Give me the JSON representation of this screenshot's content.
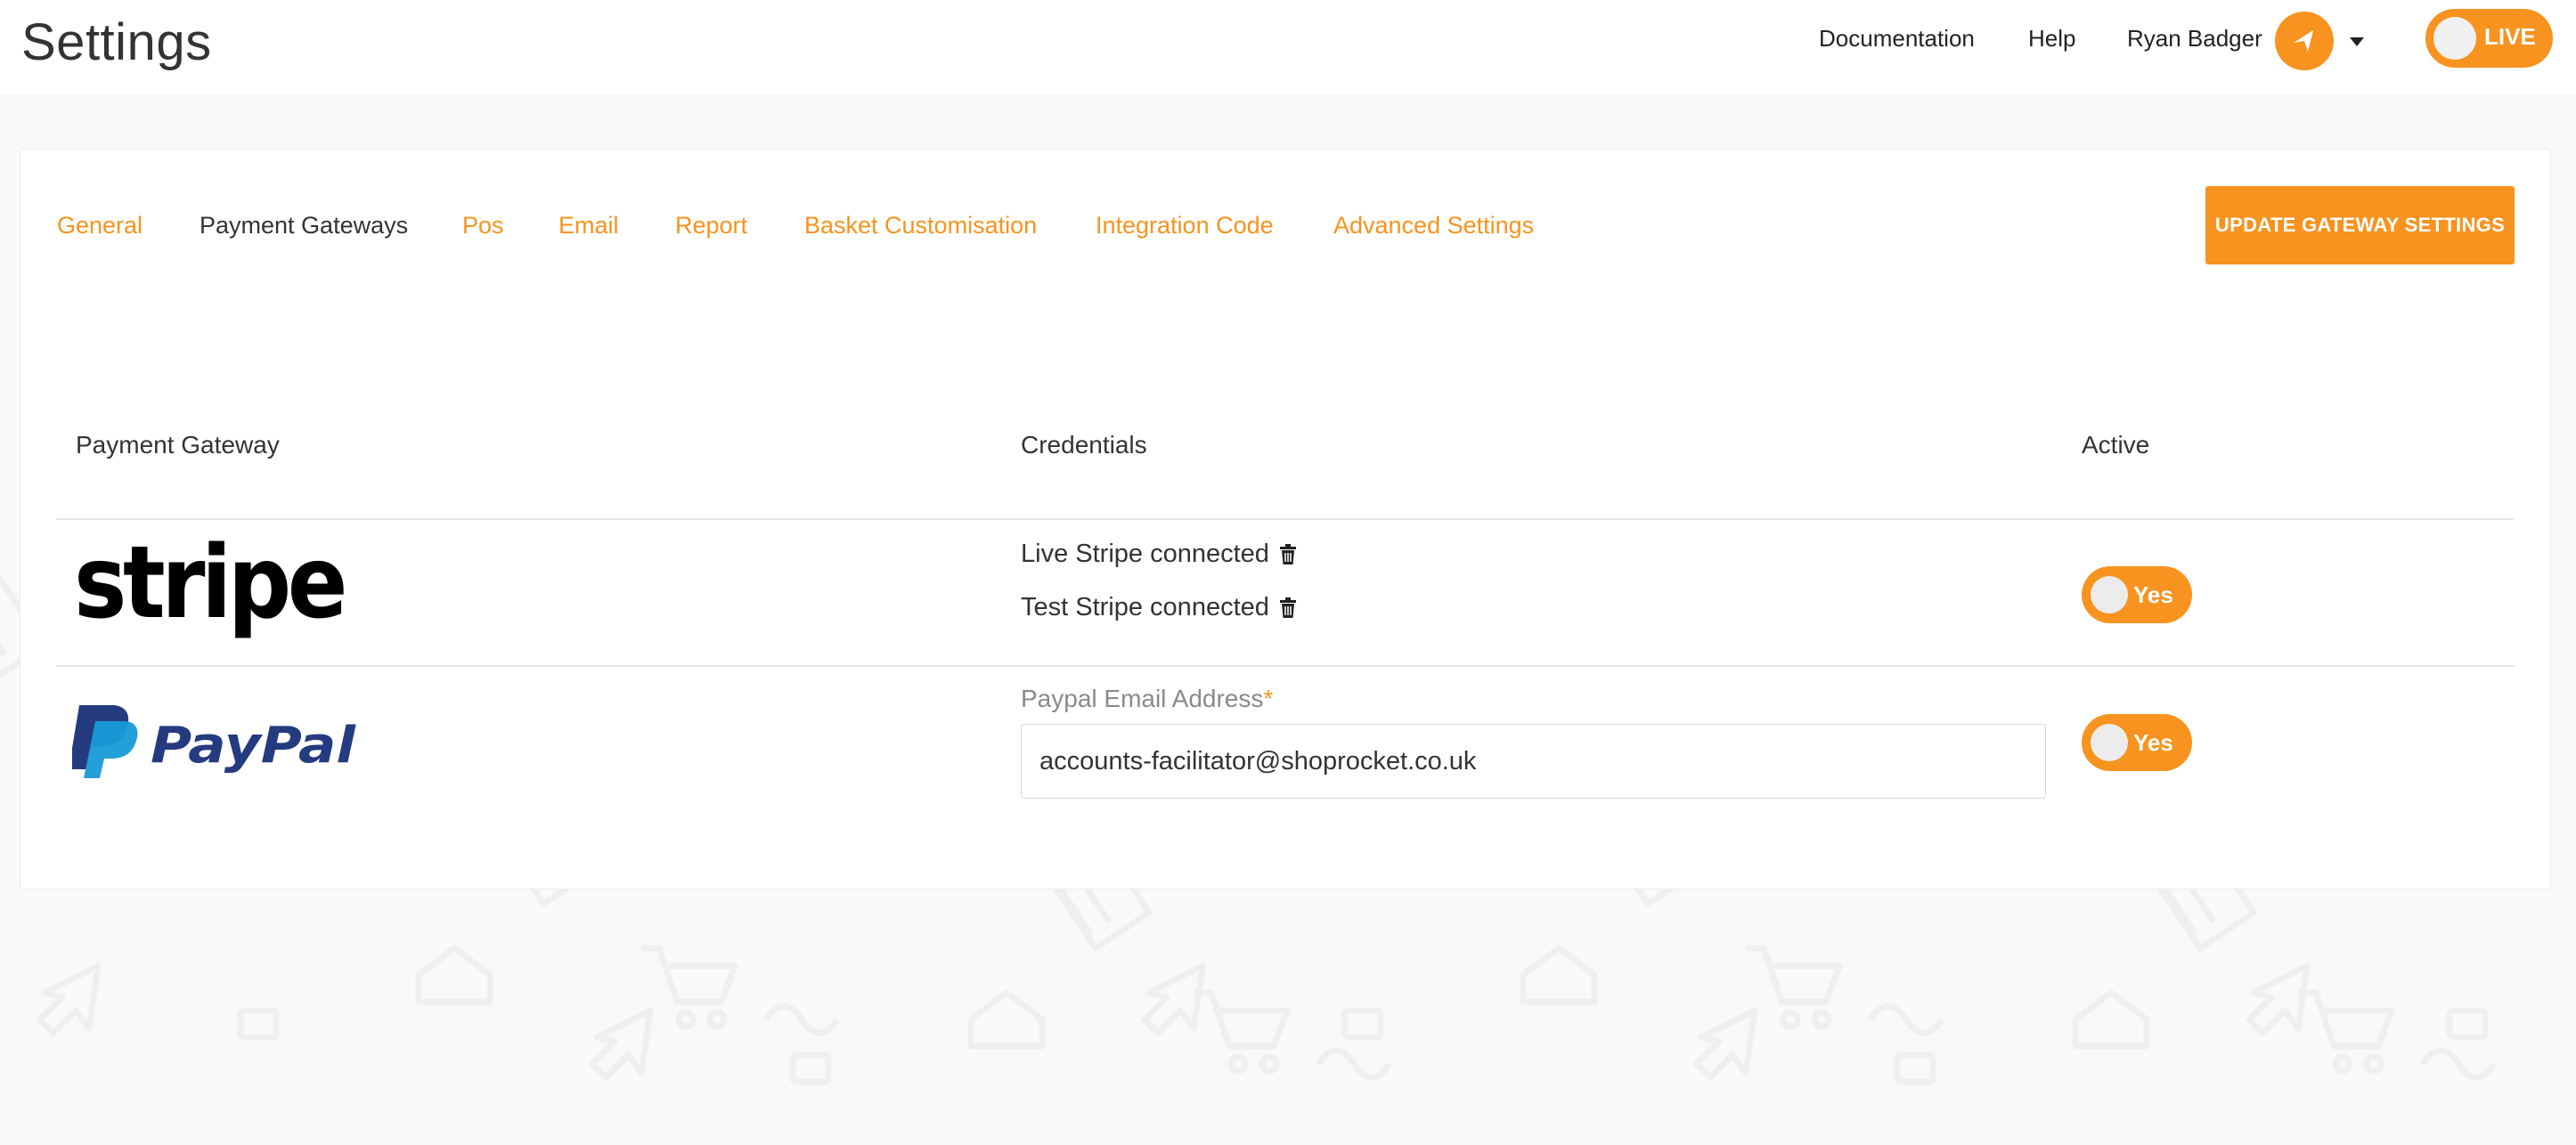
{
  "header": {
    "title": "Settings",
    "nav": {
      "documentation": "Documentation",
      "help": "Help",
      "user_name": "Ryan Badger"
    },
    "live_toggle_label": "LIVE",
    "live_toggle_on": true
  },
  "tabs": [
    {
      "label": "General",
      "active": false
    },
    {
      "label": "Payment Gateways",
      "active": true
    },
    {
      "label": "Pos",
      "active": false
    },
    {
      "label": "Email",
      "active": false
    },
    {
      "label": "Report",
      "active": false
    },
    {
      "label": "Basket Customisation",
      "active": false
    },
    {
      "label": "Integration Code",
      "active": false
    },
    {
      "label": "Advanced Settings",
      "active": false
    }
  ],
  "update_button_label": "UPDATE GATEWAY SETTINGS",
  "table": {
    "headers": {
      "gateway": "Payment Gateway",
      "credentials": "Credentials",
      "active": "Active"
    },
    "rows": {
      "stripe": {
        "logo_text": "stripe",
        "live_status": "Live Stripe connected",
        "test_status": "Test Stripe connected",
        "active_label": "Yes",
        "active": true
      },
      "paypal": {
        "logo_text": "PayPal",
        "email_label": "Paypal Email Address",
        "required_mark": "*",
        "email_value": "accounts-facilitator@shoprocket.co.uk",
        "active_label": "Yes",
        "active": true
      }
    }
  },
  "colors": {
    "accent": "#f7931e",
    "paypal_dark": "#253b80",
    "paypal_light": "#179bd7"
  }
}
